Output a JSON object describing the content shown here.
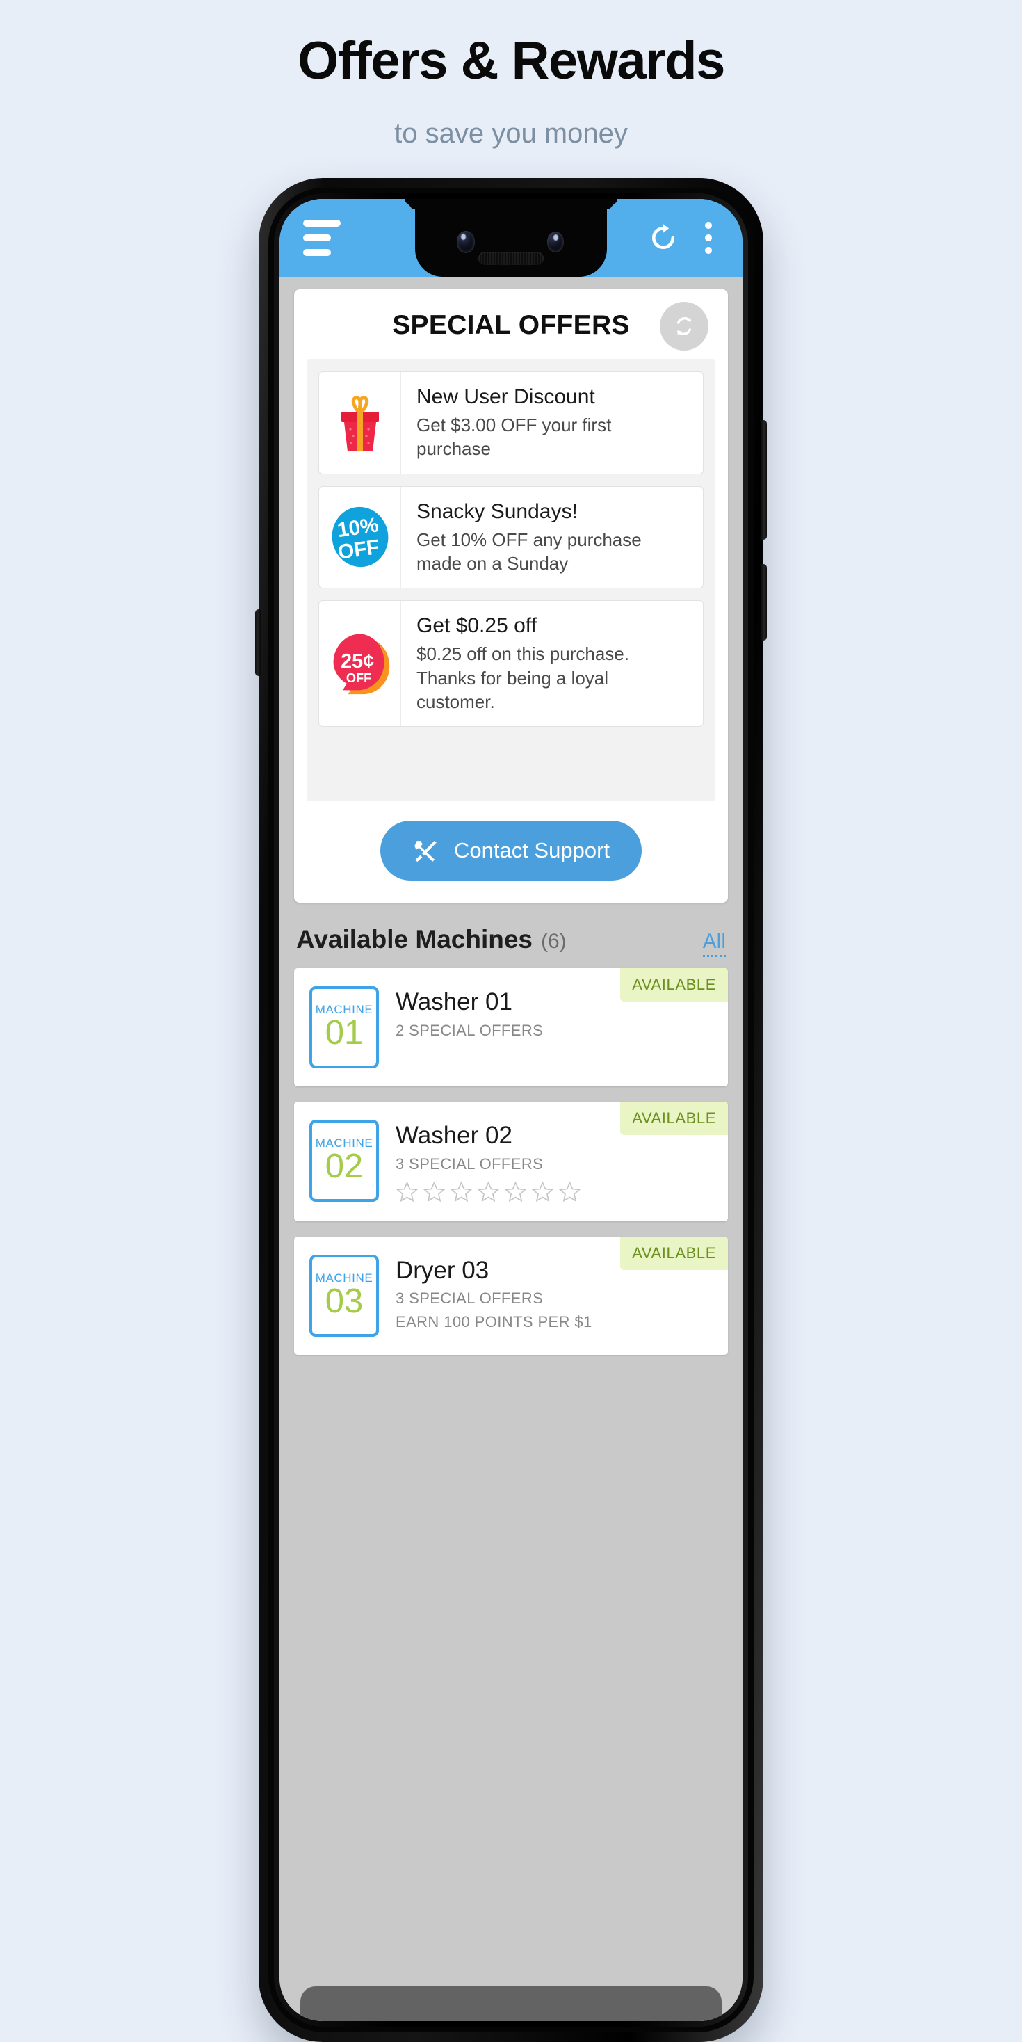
{
  "promo": {
    "title": "Offers & Rewards",
    "subtitle": "to save you money"
  },
  "appbar": {
    "menu_icon": "hamburger-menu-icon",
    "refresh_icon": "refresh-icon",
    "overflow_icon": "overflow-menu-icon",
    "background_color": "#52afeb"
  },
  "offers_card": {
    "title": "SPECIAL OFFERS",
    "sync_icon": "sync-refresh-icon",
    "offers": [
      {
        "icon": "gift-box-icon",
        "title": "New User Discount",
        "description": "Get $3.00 OFF your first purchase"
      },
      {
        "icon": "ten-percent-off-badge-icon",
        "badge_line1": "10%",
        "badge_line2": "OFF",
        "title": "Snacky Sundays!",
        "description": "Get 10% OFF any purchase made on a Sunday"
      },
      {
        "icon": "twentyfive-cents-off-badge-icon",
        "badge_line1": "25¢",
        "badge_line2": "OFF",
        "title": "Get $0.25 off",
        "description": "$0.25 off on this purchase. Thanks for being a loyal customer."
      }
    ],
    "support_button": {
      "label": "Contact Support",
      "icon": "tools-wrench-screwdriver-icon",
      "color": "#4a9fdc"
    }
  },
  "machines_section": {
    "title": "Available Machines",
    "count": "(6)",
    "filter_link": "All",
    "machines": [
      {
        "badge_word": "MACHINE",
        "badge_number": "01",
        "name": "Washer 01",
        "offers_text": "2 SPECIAL OFFERS",
        "extra_text": "",
        "stars": 0,
        "status": "AVAILABLE"
      },
      {
        "badge_word": "MACHINE",
        "badge_number": "02",
        "name": "Washer 02",
        "offers_text": "3 SPECIAL OFFERS",
        "extra_text": "",
        "stars": 7,
        "status": "AVAILABLE"
      },
      {
        "badge_word": "MACHINE",
        "badge_number": "03",
        "name": "Dryer 03",
        "offers_text": "3 SPECIAL OFFERS",
        "extra_text": "EARN 100 POINTS PER $1",
        "stars": 0,
        "status": "AVAILABLE"
      }
    ]
  },
  "colors": {
    "page_background": "#e8eef8",
    "accent_blue": "#4a9fdc",
    "badge_green_bg": "#e9f5c4",
    "badge_green_text": "#6d8f20",
    "machine_number_green": "#a4cc4a",
    "machine_border_blue": "#3fa3e8"
  }
}
